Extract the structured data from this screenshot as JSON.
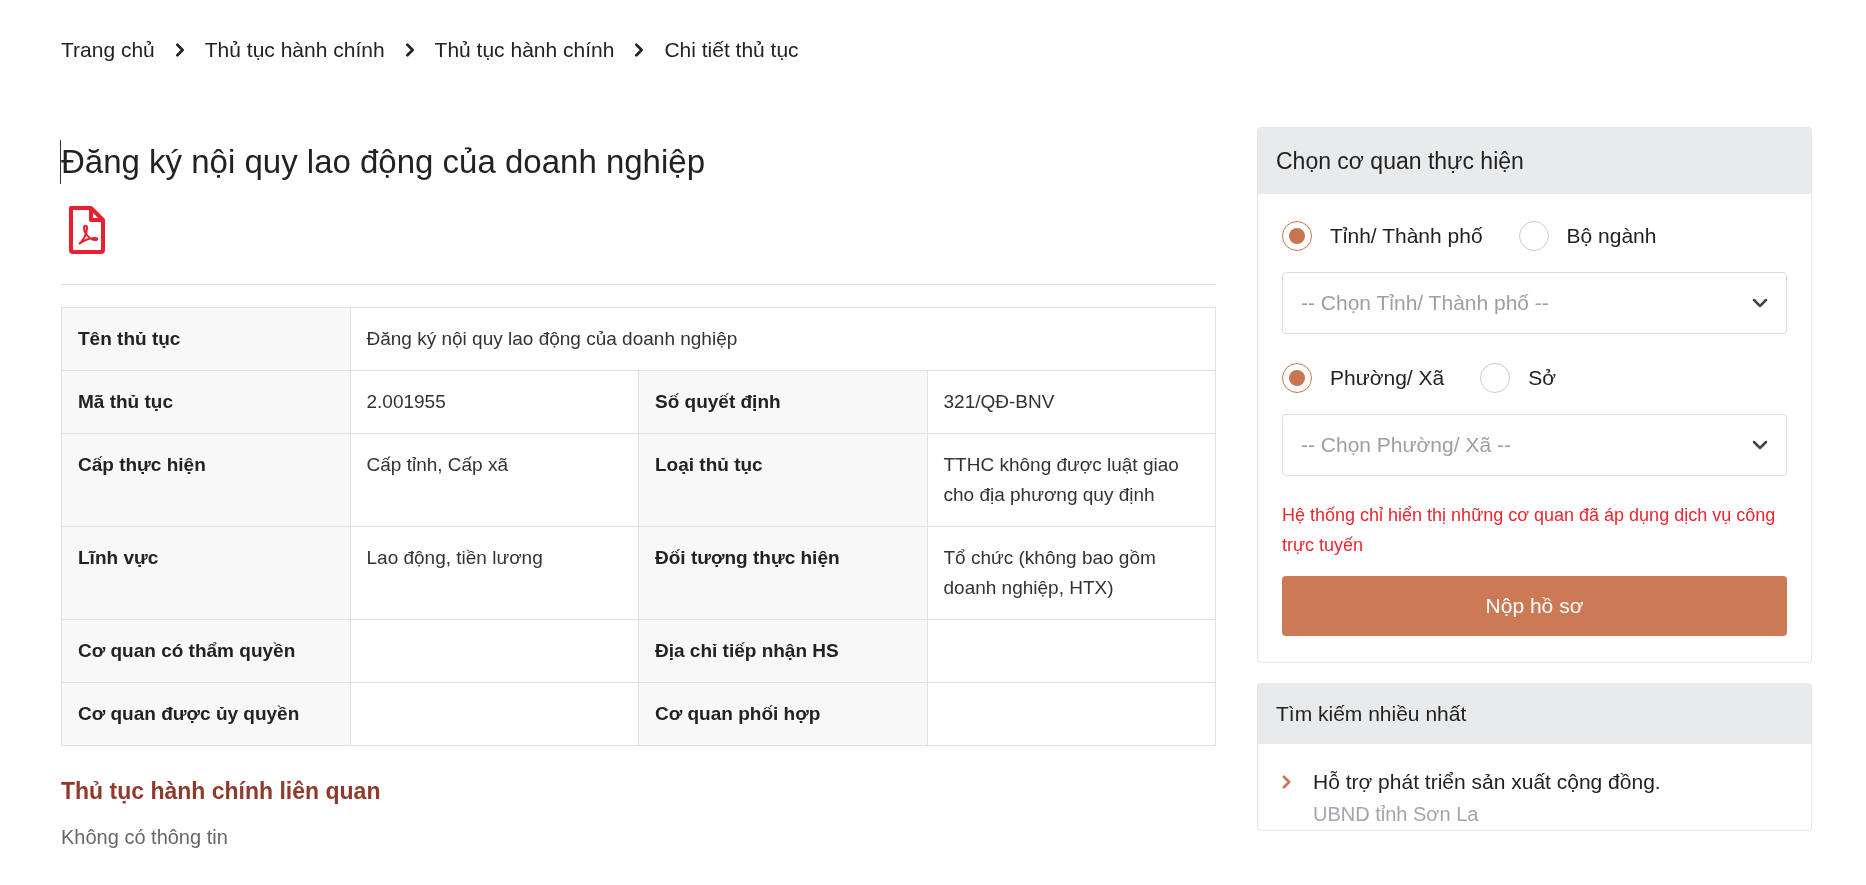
{
  "breadcrumb": [
    {
      "label": "Trang chủ"
    },
    {
      "label": "Thủ tục hành chính"
    },
    {
      "label": "Thủ tục hành chính"
    },
    {
      "label": "Chi tiết thủ tục"
    }
  ],
  "title": "Đăng ký nội quy lao động của doanh nghiệp",
  "table": {
    "rows": [
      {
        "cells": [
          {
            "kind": "label",
            "text": "Tên thủ tục"
          },
          {
            "kind": "value",
            "text": "Đăng ký nội quy lao động của doanh nghiệp",
            "colspan": 3
          }
        ]
      },
      {
        "cells": [
          {
            "kind": "label",
            "text": "Mã thủ tục"
          },
          {
            "kind": "value",
            "text": "2.001955"
          },
          {
            "kind": "label",
            "text": "Số quyết định"
          },
          {
            "kind": "value",
            "text": "321/QĐ-BNV"
          }
        ]
      },
      {
        "cells": [
          {
            "kind": "label",
            "text": "Cấp thực hiện"
          },
          {
            "kind": "value",
            "text": "Cấp tỉnh, Cấp xã"
          },
          {
            "kind": "label",
            "text": "Loại thủ tục"
          },
          {
            "kind": "value",
            "text": "TTHC không được luật giao cho địa phương quy định"
          }
        ]
      },
      {
        "cells": [
          {
            "kind": "label",
            "text": "Lĩnh vực"
          },
          {
            "kind": "value",
            "text": "Lao động, tiền lương"
          },
          {
            "kind": "label",
            "text": "Đối tượng thực hiện"
          },
          {
            "kind": "value",
            "text": "Tổ chức (không bao gồm doanh nghiệp, HTX)"
          }
        ]
      },
      {
        "cells": [
          {
            "kind": "label",
            "text": "Cơ quan có thẩm quyền"
          },
          {
            "kind": "value"
          },
          {
            "kind": "label",
            "text": "Địa chỉ tiếp nhận HS"
          },
          {
            "kind": "value"
          }
        ]
      },
      {
        "cells": [
          {
            "kind": "label",
            "text": "Cơ quan được ủy quyền"
          },
          {
            "kind": "value"
          },
          {
            "kind": "label",
            "text": "Cơ quan phối hợp"
          },
          {
            "kind": "value"
          }
        ]
      }
    ]
  },
  "related": {
    "heading": "Thủ tục hành chính liên quan",
    "text": "Không có thông tin"
  },
  "agency_panel": {
    "title": "Chọn cơ quan thực hiện",
    "groups": [
      {
        "options": [
          {
            "label": "Tỉnh/ Thành phố",
            "selected": true
          },
          {
            "label": "Bộ ngành",
            "selected": false
          }
        ],
        "select": {
          "placeholder": "-- Chọn Tỉnh/ Thành phố --"
        }
      },
      {
        "options": [
          {
            "label": "Phường/ Xã",
            "selected": true
          },
          {
            "label": "Sở",
            "selected": false
          }
        ],
        "select": {
          "placeholder": "-- Chọn Phường/ Xã --"
        }
      }
    ],
    "note": "Hệ thống chỉ hiển thị những cơ quan đã áp dụng dịch vụ công trực tuyến",
    "button": "Nộp hồ sơ"
  },
  "popular_panel": {
    "title": "Tìm kiếm nhiều nhất",
    "items": [
      {
        "title": "Hỗ trợ phát triển sản xuất cộng đồng.",
        "subtitle": "UBND tỉnh Sơn La"
      }
    ]
  }
}
